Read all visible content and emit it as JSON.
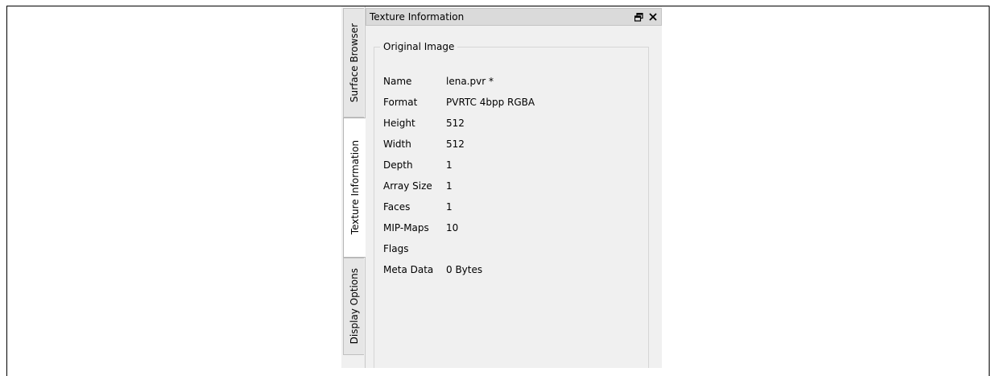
{
  "side_tabs": [
    "Surface Browser",
    "Texture Information",
    "Display Options"
  ],
  "active_tab": "Texture Information",
  "panel": {
    "title": "Texture Information",
    "float_icon": "restore-window-icon",
    "close_icon": "close-icon",
    "group_title": "Original Image",
    "rows": [
      {
        "label": "Name",
        "value": "lena.pvr *"
      },
      {
        "label": "Format",
        "value": "PVRTC 4bpp RGBA"
      },
      {
        "label": "Height",
        "value": "512"
      },
      {
        "label": "Width",
        "value": "512"
      },
      {
        "label": "Depth",
        "value": "1"
      },
      {
        "label": "Array Size",
        "value": "1"
      },
      {
        "label": "Faces",
        "value": "1"
      },
      {
        "label": "MIP-Maps",
        "value": "10"
      },
      {
        "label": "Flags",
        "value": ""
      },
      {
        "label": "Meta Data",
        "value": "0 Bytes"
      }
    ]
  }
}
